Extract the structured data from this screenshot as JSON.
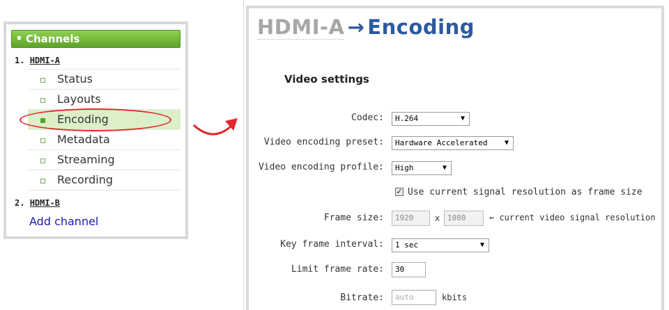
{
  "sidebar": {
    "header": "Channels",
    "channels": [
      {
        "title": "HDMI-A",
        "number": "1.",
        "items": [
          {
            "label": "Status"
          },
          {
            "label": "Layouts"
          },
          {
            "label": "Encoding"
          },
          {
            "label": "Metadata"
          },
          {
            "label": "Streaming"
          },
          {
            "label": "Recording"
          }
        ]
      },
      {
        "title": "HDMI-B",
        "number": "2."
      }
    ],
    "add_channel": "Add channel",
    "active_item": "Encoding"
  },
  "header": {
    "breadcrumb": "HDMI-A",
    "arrow": "→",
    "current": "Encoding"
  },
  "video_settings": {
    "section_title": "Video settings",
    "codec": {
      "label": "Codec:",
      "value": "H.264"
    },
    "preset": {
      "label": "Video encoding preset:",
      "value": "Hardware Accelerated"
    },
    "profile": {
      "label": "Video encoding profile:",
      "value": "High"
    },
    "use_signal_res": {
      "checked": true,
      "label": "Use current signal resolution as frame size"
    },
    "frame_size": {
      "label": "Frame size:",
      "width": "1920",
      "separator": "x",
      "height": "1080",
      "note": "← current video signal resolution"
    },
    "key_frame": {
      "label": "Key frame interval:",
      "value": "1 sec"
    },
    "limit_frame_rate": {
      "label": "Limit frame rate:",
      "value": "30"
    },
    "bitrate": {
      "label": "Bitrate:",
      "placeholder": "auto",
      "unit": "kbits"
    }
  },
  "colors": {
    "accent_blue": "#2c5aa0",
    "channels_green": "#6db33f",
    "annotation_red": "#e3262b"
  }
}
